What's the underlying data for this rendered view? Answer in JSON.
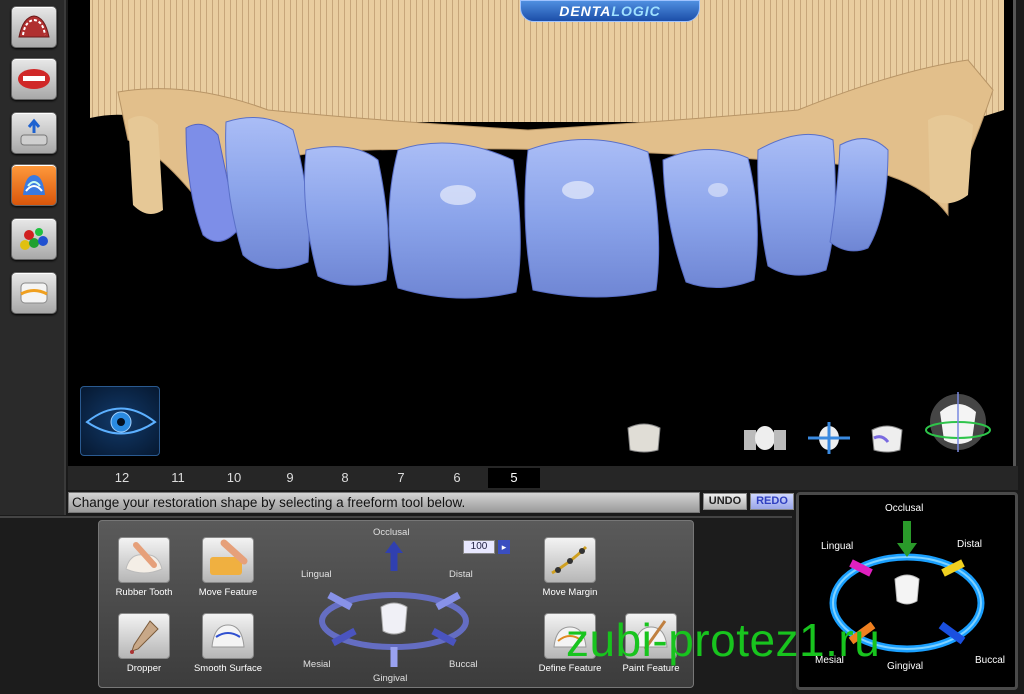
{
  "app": {
    "logo_part1": "DENTA",
    "logo_part2": "LOGIC"
  },
  "left_toolbar": {
    "tools": [
      {
        "icon": "arch-model-icon"
      },
      {
        "icon": "lips-icon"
      },
      {
        "icon": "tooth-insert-icon"
      },
      {
        "icon": "tooth-layers-icon",
        "active": true
      },
      {
        "icon": "color-balls-icon"
      },
      {
        "icon": "tooth-margin-icon"
      }
    ]
  },
  "viewport": {
    "view_icons": [
      "tooth-occlusal-view-icon",
      "tooth-pair-icon",
      "tooth-transform-icon",
      "tooth-single-icon",
      "tooth-rotate-view-icon"
    ]
  },
  "tooth_tabs": [
    "12",
    "11",
    "10",
    "9",
    "8",
    "7",
    "6",
    "5"
  ],
  "tooth_tabs_selected": "5",
  "instruction": "Change your restoration shape by selecting a freeform tool below.",
  "buttons": {
    "undo": "UNDO",
    "redo": "REDO"
  },
  "tools": [
    {
      "label": "Rubber Tooth",
      "icon": "rubber-tooth-icon"
    },
    {
      "label": "Move Feature",
      "icon": "move-feature-icon"
    },
    {
      "label": "Dropper",
      "icon": "dropper-icon"
    },
    {
      "label": "Smooth Surface",
      "icon": "smooth-surface-icon"
    },
    {
      "label": "Move Margin",
      "icon": "move-margin-icon"
    },
    {
      "label": "Define Feature",
      "icon": "define-feature-icon"
    },
    {
      "label": "Paint Feature",
      "icon": "paint-feature-icon"
    }
  ],
  "directions": {
    "occlusal": "Occlusal",
    "lingual": "Lingual",
    "distal": "Distal",
    "mesial": "Mesial",
    "buccal": "Buccal",
    "gingival": "Gingival"
  },
  "strength": "100",
  "orientation": {
    "occlusal": "Occlusal",
    "lingual": "Lingual",
    "distal": "Distal",
    "gingival": "Gingival",
    "mesial": "Mesial",
    "buccal": "Buccal"
  },
  "watermark": "zubi-protez1.ru",
  "colors": {
    "tooth": "#8fa8ec",
    "model": "#e8c99a",
    "accent": "#ff7a1a",
    "ring": "#1aa0ff"
  }
}
